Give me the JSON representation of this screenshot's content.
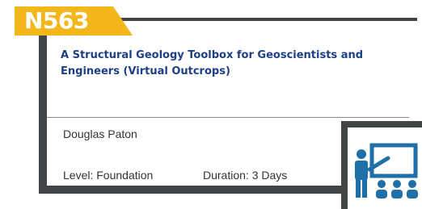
{
  "course": {
    "code": "N563",
    "title": "A Structural Geology Toolbox for Geoscientists and Engineers (Virtual Outcrops)",
    "author": "Douglas Paton",
    "level": "Level: Foundation",
    "duration": "Duration: 3 Days"
  },
  "icons": {
    "course_type": "classroom-presenter-icon"
  },
  "colors": {
    "badge": "#f3b61b",
    "title": "#1c3f86",
    "frame": "#414545",
    "icon": "#1f6fa8"
  }
}
